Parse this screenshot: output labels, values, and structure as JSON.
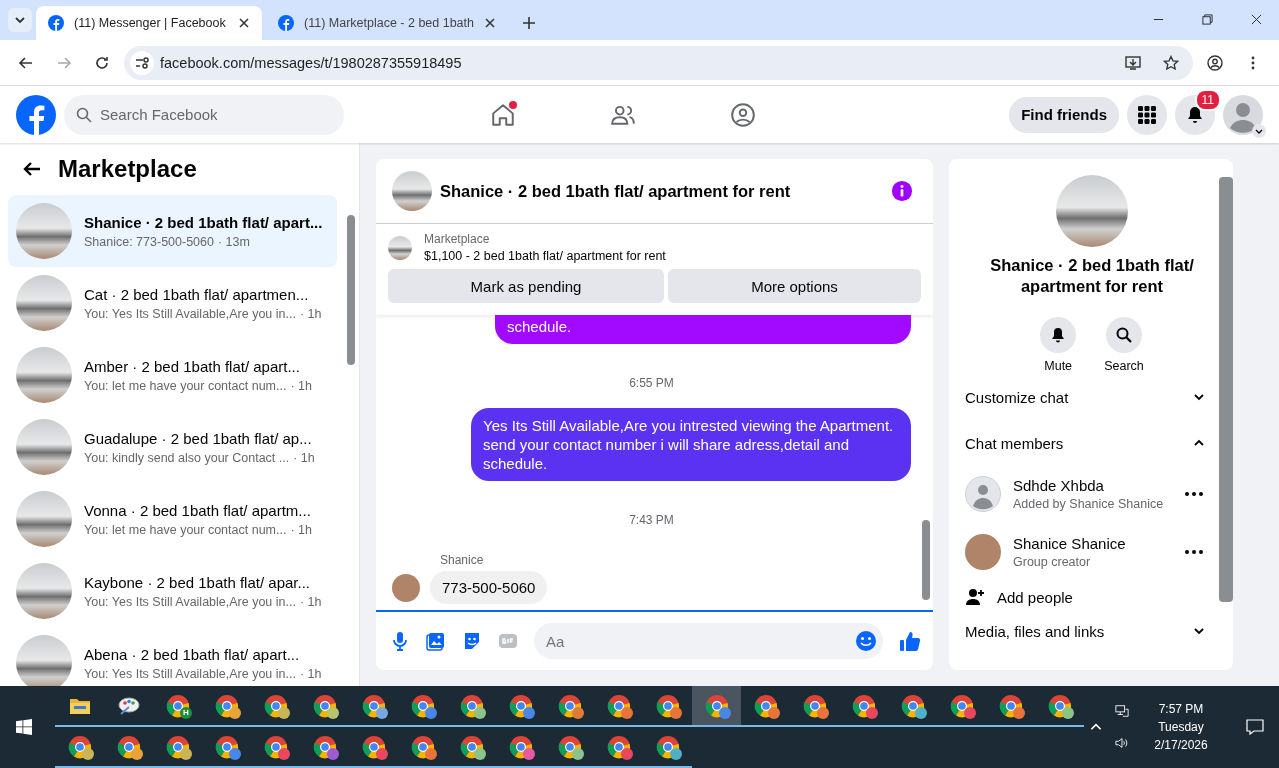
{
  "browser": {
    "tabs": [
      {
        "title": "(11) Messenger | Facebook",
        "selected": true
      },
      {
        "title": "(11) Marketplace - 2 bed 1bath",
        "selected": false
      }
    ],
    "url": "facebook.com/messages/t/1980287355918495"
  },
  "header": {
    "search_placeholder": "Search Facebook",
    "nav": [
      {
        "kind": "home",
        "notification_dot": true
      },
      {
        "kind": "friends",
        "notification_dot": false
      },
      {
        "kind": "groups",
        "notification_dot": false
      }
    ],
    "find_friends": "Find friends",
    "notifications_count": "11"
  },
  "sidebar": {
    "title": "Marketplace",
    "conversations": [
      {
        "title": "Shanice · 2 bed 1bath flat/ apart...",
        "preview": "Shanice: 773-500-5060",
        "time": "· 13m",
        "selected": true
      },
      {
        "title": "Cat · 2 bed 1bath flat/ apartmen...",
        "preview": "You: Yes Its Still Available,Are you in...",
        "time": "· 1h",
        "selected": false
      },
      {
        "title": "Amber · 2 bed 1bath flat/ apart...",
        "preview": "You: let me have your contact num...",
        "time": "· 1h",
        "selected": false
      },
      {
        "title": "Guadalupe · 2 bed 1bath flat/ ap...",
        "preview": "You: kindly send also your Contact ...",
        "time": "· 1h",
        "selected": false
      },
      {
        "title": "Vonna · 2 bed 1bath flat/ apartm...",
        "preview": "You: let me have your contact num...",
        "time": "· 1h",
        "selected": false
      },
      {
        "title": "Kaybone · 2 bed 1bath flat/ apar...",
        "preview": "You: Yes Its Still Available,Are you in...",
        "time": "· 1h",
        "selected": false
      },
      {
        "title": "Abena · 2 bed 1bath flat/ apart...",
        "preview": "You: Yes Its Still Available,Are you in...",
        "time": "· 1h",
        "selected": false
      }
    ]
  },
  "chat": {
    "title": "Shanice · 2 bed 1bath flat/ apartment for rent",
    "listing": {
      "source": "Marketplace",
      "text": "$1,100 - 2 bed 1bath flat/ apartment for rent"
    },
    "buttons": [
      "Mark as pending",
      "More options"
    ],
    "messages": [
      {
        "kind": "outgoing",
        "text": "schedule.",
        "color": "#a10aff"
      },
      {
        "kind": "time",
        "text": "6:55 PM"
      },
      {
        "kind": "outgoing",
        "text": "Yes Its Still Available,Are you intrested viewing the Apartment. send your contact number i will share adress,detail and schedule.",
        "color": "#5b32f2"
      },
      {
        "kind": "time",
        "text": "7:43 PM"
      },
      {
        "kind": "incoming",
        "sender": "Shanice",
        "text": "773-500-5060"
      }
    ],
    "input_placeholder": "Aa"
  },
  "details": {
    "title": "Shanice · 2 bed 1bath flat/ apartment for rent",
    "actions": [
      {
        "kind": "mute",
        "label": "Mute"
      },
      {
        "kind": "search",
        "label": "Search"
      }
    ],
    "sections": [
      {
        "label": "Customize chat",
        "expanded": false
      },
      {
        "label": "Chat members",
        "expanded": true
      }
    ],
    "members": [
      {
        "name": "Sdhde Xhbda",
        "role": "Added by Shanice Shanice",
        "kind": "default"
      },
      {
        "name": "Shanice Shanice",
        "role": "Group creator",
        "kind": "photo"
      }
    ],
    "add_people": "Add people",
    "media_section": {
      "label": "Media, files and links",
      "expanded": false
    }
  },
  "taskbar": {
    "rows": [
      [
        {
          "kind": "folder",
          "selected": false
        },
        {
          "kind": "paint",
          "selected": false
        },
        {
          "kind": "browser",
          "color": "#1e8e3e",
          "letter": "H",
          "selected": false
        },
        {
          "kind": "browser",
          "color": "#e8a33d",
          "selected": false
        },
        {
          "kind": "browser",
          "color": "#c9b458",
          "selected": false
        },
        {
          "kind": "browser",
          "color": "#b9c46a",
          "selected": false
        },
        {
          "kind": "browser",
          "color": "#7aa7e0",
          "selected": false
        },
        {
          "kind": "browser",
          "color": "#4a86e8",
          "selected": false
        },
        {
          "kind": "browser",
          "color": "#8bc48a",
          "selected": false
        },
        {
          "kind": "browser",
          "color": "#4a86e8",
          "selected": false
        },
        {
          "kind": "browser",
          "color": "#e07b39",
          "selected": false
        },
        {
          "kind": "browser",
          "color": "#e8743b",
          "selected": false
        },
        {
          "kind": "browser",
          "color": "#e8743b",
          "selected": false
        },
        {
          "kind": "browser",
          "color": "#4a86e8",
          "selected": true
        },
        {
          "kind": "browser",
          "color": "#e8743b",
          "selected": false
        },
        {
          "kind": "browser",
          "color": "#e8743b",
          "selected": false
        },
        {
          "kind": "browser",
          "color": "#e8475f",
          "selected": false
        },
        {
          "kind": "browser",
          "color": "#4fb0c6",
          "selected": false
        },
        {
          "kind": "browser",
          "color": "#e8475f",
          "selected": false
        },
        {
          "kind": "browser",
          "color": "#e8743b",
          "selected": false
        },
        {
          "kind": "browser",
          "color": "#8bc48a",
          "selected": false
        }
      ],
      [
        {
          "kind": "browser",
          "color": "#c9b458",
          "selected": false
        },
        {
          "kind": "browser",
          "color": "#e8a33d",
          "selected": false
        },
        {
          "kind": "browser",
          "color": "#c9b458",
          "selected": false
        },
        {
          "kind": "browser",
          "color": "#4a86e8",
          "selected": false
        },
        {
          "kind": "browser",
          "color": "#e8475f",
          "selected": false
        },
        {
          "kind": "browser",
          "color": "#a05ad6",
          "selected": false
        },
        {
          "kind": "browser",
          "color": "#e8475f",
          "selected": false
        },
        {
          "kind": "browser",
          "color": "#e8743b",
          "selected": false
        },
        {
          "kind": "browser",
          "color": "#8bc48a",
          "selected": false
        },
        {
          "kind": "browser",
          "color": "#e85aa0",
          "selected": false
        },
        {
          "kind": "browser",
          "color": "#8bc48a",
          "selected": false
        },
        {
          "kind": "browser",
          "color": "#e8475f",
          "selected": false
        },
        {
          "kind": "browser",
          "color": "#4fb0c6",
          "selected": false
        }
      ]
    ],
    "time": "7:57 PM",
    "day": "Tuesday",
    "date": "2/17/2026"
  }
}
